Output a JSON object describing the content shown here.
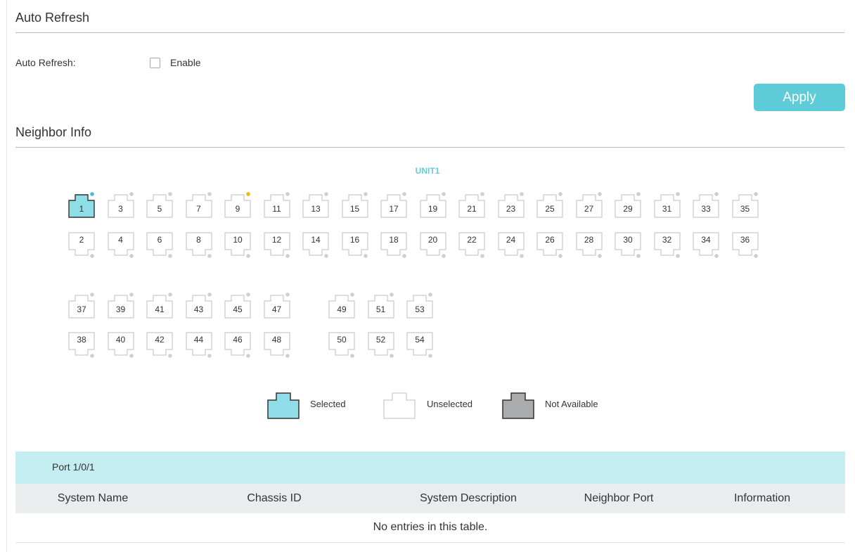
{
  "auto_refresh": {
    "title": "Auto Refresh",
    "field_label": "Auto Refresh:",
    "checkbox_label": "Enable",
    "checked": false,
    "apply_label": "Apply"
  },
  "neighbor_info": {
    "title": "Neighbor Info",
    "unit_label": "UNIT1",
    "ports": [
      {
        "number": "1",
        "state": "selected",
        "indicator": "link"
      },
      {
        "number": "2",
        "state": "unselected"
      },
      {
        "number": "3",
        "state": "unselected"
      },
      {
        "number": "4",
        "state": "unselected"
      },
      {
        "number": "5",
        "state": "unselected"
      },
      {
        "number": "6",
        "state": "unselected"
      },
      {
        "number": "7",
        "state": "unselected"
      },
      {
        "number": "8",
        "state": "unselected"
      },
      {
        "number": "9",
        "state": "unselected",
        "indicator": "warning"
      },
      {
        "number": "10",
        "state": "unselected"
      },
      {
        "number": "11",
        "state": "unselected"
      },
      {
        "number": "12",
        "state": "unselected"
      },
      {
        "number": "13",
        "state": "unselected"
      },
      {
        "number": "14",
        "state": "unselected"
      },
      {
        "number": "15",
        "state": "unselected"
      },
      {
        "number": "16",
        "state": "unselected"
      },
      {
        "number": "17",
        "state": "unselected"
      },
      {
        "number": "18",
        "state": "unselected"
      },
      {
        "number": "19",
        "state": "unselected"
      },
      {
        "number": "20",
        "state": "unselected"
      },
      {
        "number": "21",
        "state": "unselected"
      },
      {
        "number": "22",
        "state": "unselected"
      },
      {
        "number": "23",
        "state": "unselected"
      },
      {
        "number": "24",
        "state": "unselected"
      },
      {
        "number": "25",
        "state": "unselected"
      },
      {
        "number": "26",
        "state": "unselected"
      },
      {
        "number": "27",
        "state": "unselected"
      },
      {
        "number": "28",
        "state": "unselected"
      },
      {
        "number": "29",
        "state": "unselected"
      },
      {
        "number": "30",
        "state": "unselected"
      },
      {
        "number": "31",
        "state": "unselected"
      },
      {
        "number": "32",
        "state": "unselected"
      },
      {
        "number": "33",
        "state": "unselected"
      },
      {
        "number": "34",
        "state": "unselected"
      },
      {
        "number": "35",
        "state": "unselected"
      },
      {
        "number": "36",
        "state": "unselected"
      },
      {
        "number": "37",
        "state": "unselected"
      },
      {
        "number": "38",
        "state": "unselected"
      },
      {
        "number": "39",
        "state": "unselected"
      },
      {
        "number": "40",
        "state": "unselected"
      },
      {
        "number": "41",
        "state": "unselected"
      },
      {
        "number": "42",
        "state": "unselected"
      },
      {
        "number": "43",
        "state": "unselected"
      },
      {
        "number": "44",
        "state": "unselected"
      },
      {
        "number": "45",
        "state": "unselected"
      },
      {
        "number": "46",
        "state": "unselected"
      },
      {
        "number": "47",
        "state": "unselected"
      },
      {
        "number": "48",
        "state": "unselected"
      },
      {
        "number": "49",
        "state": "unselected"
      },
      {
        "number": "50",
        "state": "unselected"
      },
      {
        "number": "51",
        "state": "unselected"
      },
      {
        "number": "52",
        "state": "unselected"
      },
      {
        "number": "53",
        "state": "unselected"
      },
      {
        "number": "54",
        "state": "unselected"
      }
    ],
    "legend": {
      "selected": "Selected",
      "unselected": "Unselected",
      "not_available": "Not Available"
    }
  },
  "table": {
    "port_title": "Port 1/0/1",
    "columns": [
      "System Name",
      "Chassis ID",
      "System Description",
      "Neighbor Port",
      "Information"
    ],
    "empty_message": "No entries in this table."
  },
  "colors": {
    "accent": "#5ecbd8",
    "selected_fill": "#8fdde6",
    "not_available_fill": "#a9abad",
    "link_indicator": "#3fc0d1",
    "warning_indicator": "#f5b800",
    "table_header_bg": "#c3edf1"
  }
}
